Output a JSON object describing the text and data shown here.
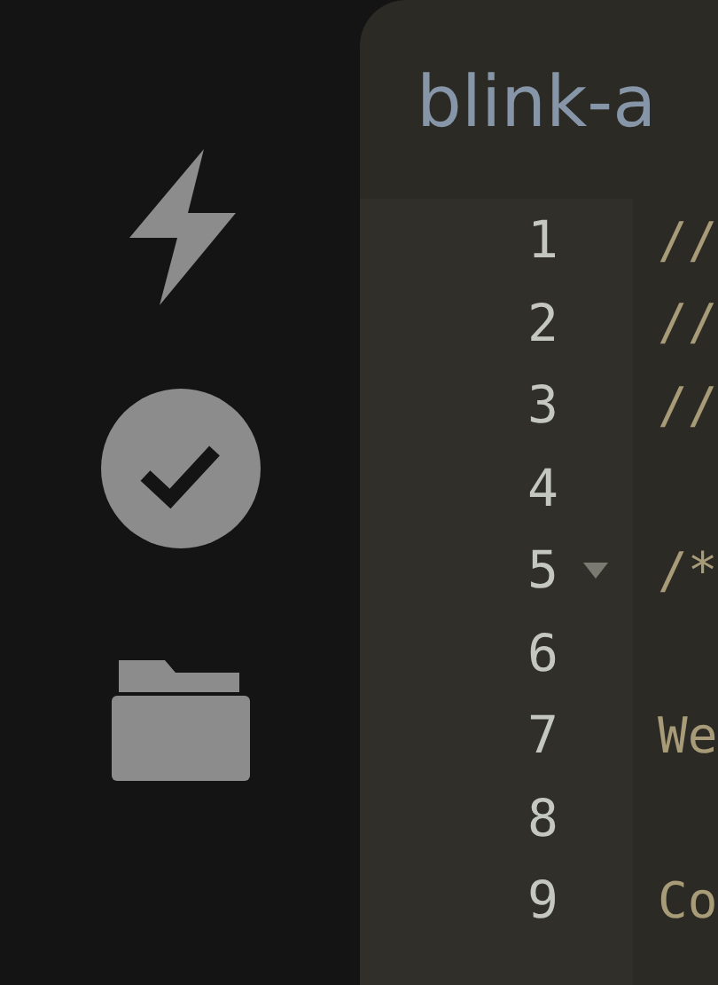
{
  "sidebar": {
    "items": [
      {
        "kind": "bolt"
      },
      {
        "kind": "check"
      },
      {
        "kind": "folder"
      }
    ]
  },
  "editor": {
    "title": "blink-a",
    "lines": [
      {
        "number": "1",
        "code": "//",
        "foldable": false
      },
      {
        "number": "2",
        "code": "//",
        "foldable": false
      },
      {
        "number": "3",
        "code": "//",
        "foldable": false
      },
      {
        "number": "4",
        "foldable": false
      },
      {
        "number": "5",
        "code": "/*",
        "foldable": true
      },
      {
        "number": "6",
        "foldable": false
      },
      {
        "number": "7",
        "code": "We",
        "foldable": false
      },
      {
        "number": "8",
        "foldable": false
      },
      {
        "number": "9",
        "code": "Co",
        "foldable": false
      }
    ]
  }
}
